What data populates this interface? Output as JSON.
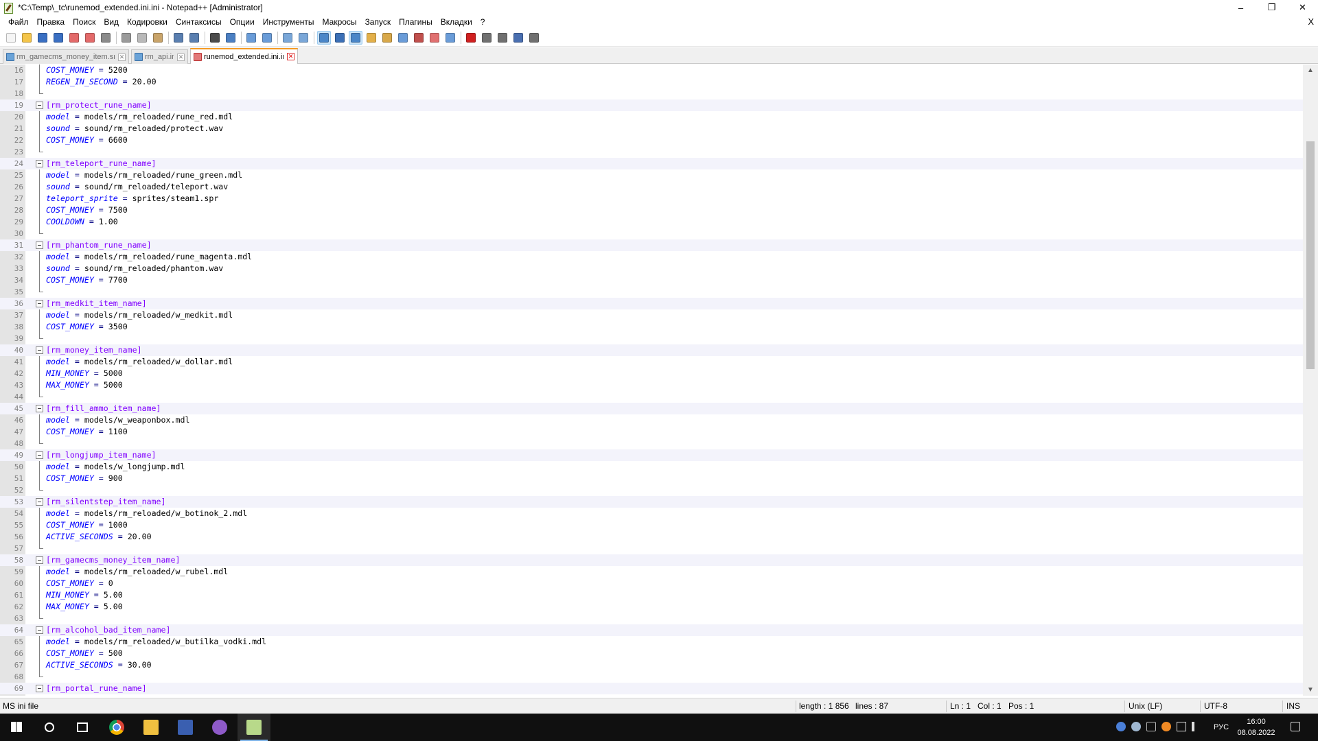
{
  "window": {
    "title": "*C:\\Temp\\_tc\\runemod_extended.ini.ini - Notepad++ [Administrator]",
    "minimize": "–",
    "maximize": "❐",
    "close": "✕"
  },
  "menu": {
    "items": [
      "Файл",
      "Правка",
      "Поиск",
      "Вид",
      "Кодировки",
      "Синтаксисы",
      "Опции",
      "Инструменты",
      "Макросы",
      "Запуск",
      "Плагины",
      "Вкладки",
      "?"
    ],
    "close_doc": "X"
  },
  "toolbar": {
    "buttons": [
      {
        "icon": "new-file-icon",
        "color": "#f5f5f5"
      },
      {
        "icon": "open-file-icon",
        "color": "#f4c54a"
      },
      {
        "icon": "save-icon",
        "color": "#3a6fc2"
      },
      {
        "icon": "save-all-icon",
        "color": "#3a6fc2"
      },
      {
        "icon": "close-icon",
        "color": "#e36a6a"
      },
      {
        "icon": "close-all-icon",
        "color": "#e36a6a"
      },
      {
        "icon": "print-icon",
        "color": "#8a8a8a"
      },
      {
        "sep": true
      },
      {
        "icon": "cut-icon",
        "color": "#9a9a9a"
      },
      {
        "icon": "copy-icon",
        "color": "#b9b9b9"
      },
      {
        "icon": "paste-icon",
        "color": "#c9a46a"
      },
      {
        "sep": true
      },
      {
        "icon": "undo-icon",
        "color": "#5a7fb0"
      },
      {
        "icon": "redo-icon",
        "color": "#5a7fb0"
      },
      {
        "sep": true
      },
      {
        "icon": "find-icon",
        "color": "#4b4b4b"
      },
      {
        "icon": "replace-icon",
        "color": "#4b7fc2"
      },
      {
        "sep": true
      },
      {
        "icon": "zoom-in-icon",
        "color": "#6a9cd8"
      },
      {
        "icon": "zoom-out-icon",
        "color": "#6a9cd8"
      },
      {
        "sep": true
      },
      {
        "icon": "sync-vertical-icon",
        "color": "#7aa7d8"
      },
      {
        "icon": "sync-horizontal-icon",
        "color": "#7aa7d8"
      },
      {
        "sep": true
      },
      {
        "icon": "word-wrap-icon",
        "color": "#4a86c8",
        "active": true
      },
      {
        "icon": "show-all-chars-icon",
        "color": "#3b6fb6"
      },
      {
        "icon": "indent-guide-icon",
        "color": "#4a86c8",
        "active": true
      },
      {
        "icon": "udl-icon",
        "color": "#e3b04a"
      },
      {
        "icon": "doc-map-icon",
        "color": "#d8a84a"
      },
      {
        "icon": "doc-list-icon",
        "color": "#6a9cd8"
      },
      {
        "icon": "function-list-icon",
        "color": "#c0504d"
      },
      {
        "icon": "folder-workspace-icon",
        "color": "#e07070"
      },
      {
        "icon": "monitoring-icon",
        "color": "#6a9cd8"
      },
      {
        "sep": true
      },
      {
        "icon": "record-macro-icon",
        "color": "#d02020"
      },
      {
        "icon": "stop-record-icon",
        "color": "#707070"
      },
      {
        "icon": "play-macro-icon",
        "color": "#707070"
      },
      {
        "icon": "run-macro-multiple-icon",
        "color": "#4a6fb0"
      },
      {
        "icon": "save-macro-icon",
        "color": "#707070"
      }
    ]
  },
  "tabs": [
    {
      "label": "rm_gamecms_money_item.sma",
      "active": false
    },
    {
      "label": "rm_api.inc",
      "active": false
    },
    {
      "label": "runemod_extended.ini.ini",
      "active": true
    }
  ],
  "editor": {
    "lines": [
      {
        "n": "16",
        "type": "kv",
        "key": "COST_MONEY",
        "value": "5200",
        "fold": "line"
      },
      {
        "n": "17",
        "type": "kv",
        "key": "REGEN_IN_SECOND",
        "value": "20.00",
        "fold": "line"
      },
      {
        "n": "18",
        "type": "blank",
        "fold": "end"
      },
      {
        "n": "19",
        "type": "section",
        "text": "[rm_protect_rune_name]",
        "fold": "box"
      },
      {
        "n": "20",
        "type": "kv",
        "key": "model",
        "value": "models/rm_reloaded/rune_red.mdl",
        "fold": "line"
      },
      {
        "n": "21",
        "type": "kv",
        "key": "sound",
        "value": "sound/rm_reloaded/protect.wav",
        "fold": "line"
      },
      {
        "n": "22",
        "type": "kv",
        "key": "COST_MONEY",
        "value": "6600",
        "fold": "line"
      },
      {
        "n": "23",
        "type": "blank",
        "fold": "end"
      },
      {
        "n": "24",
        "type": "section",
        "text": "[rm_teleport_rune_name]",
        "fold": "box"
      },
      {
        "n": "25",
        "type": "kv",
        "key": "model",
        "value": "models/rm_reloaded/rune_green.mdl",
        "fold": "line"
      },
      {
        "n": "26",
        "type": "kv",
        "key": "sound",
        "value": "sound/rm_reloaded/teleport.wav",
        "fold": "line"
      },
      {
        "n": "27",
        "type": "kv",
        "key": "teleport_sprite",
        "value": "sprites/steam1.spr",
        "fold": "line"
      },
      {
        "n": "28",
        "type": "kv",
        "key": "COST_MONEY",
        "value": "7500",
        "fold": "line"
      },
      {
        "n": "29",
        "type": "kv",
        "key": "COOLDOWN",
        "value": "1.00",
        "fold": "line"
      },
      {
        "n": "30",
        "type": "blank",
        "fold": "end"
      },
      {
        "n": "31",
        "type": "section",
        "text": "[rm_phantom_rune_name]",
        "fold": "box"
      },
      {
        "n": "32",
        "type": "kv",
        "key": "model",
        "value": "models/rm_reloaded/rune_magenta.mdl",
        "fold": "line"
      },
      {
        "n": "33",
        "type": "kv",
        "key": "sound",
        "value": "sound/rm_reloaded/phantom.wav",
        "fold": "line"
      },
      {
        "n": "34",
        "type": "kv",
        "key": "COST_MONEY",
        "value": "7700",
        "fold": "line"
      },
      {
        "n": "35",
        "type": "blank",
        "fold": "end"
      },
      {
        "n": "36",
        "type": "section",
        "text": "[rm_medkit_item_name]",
        "fold": "box"
      },
      {
        "n": "37",
        "type": "kv",
        "key": "model",
        "value": "models/rm_reloaded/w_medkit.mdl",
        "fold": "line"
      },
      {
        "n": "38",
        "type": "kv",
        "key": "COST_MONEY",
        "value": "3500",
        "fold": "line"
      },
      {
        "n": "39",
        "type": "blank",
        "fold": "end"
      },
      {
        "n": "40",
        "type": "section",
        "text": "[rm_money_item_name]",
        "fold": "box"
      },
      {
        "n": "41",
        "type": "kv",
        "key": "model",
        "value": "models/rm_reloaded/w_dollar.mdl",
        "fold": "line"
      },
      {
        "n": "42",
        "type": "kv",
        "key": "MIN_MONEY",
        "value": "5000",
        "fold": "line"
      },
      {
        "n": "43",
        "type": "kv",
        "key": "MAX_MONEY",
        "value": "5000",
        "fold": "line"
      },
      {
        "n": "44",
        "type": "blank",
        "fold": "end"
      },
      {
        "n": "45",
        "type": "section",
        "text": "[rm_fill_ammo_item_name]",
        "fold": "box"
      },
      {
        "n": "46",
        "type": "kv",
        "key": "model",
        "value": "models/w_weaponbox.mdl",
        "fold": "line"
      },
      {
        "n": "47",
        "type": "kv",
        "key": "COST_MONEY",
        "value": "1100",
        "fold": "line"
      },
      {
        "n": "48",
        "type": "blank",
        "fold": "end"
      },
      {
        "n": "49",
        "type": "section",
        "text": "[rm_longjump_item_name]",
        "fold": "box"
      },
      {
        "n": "50",
        "type": "kv",
        "key": "model",
        "value": "models/w_longjump.mdl",
        "fold": "line"
      },
      {
        "n": "51",
        "type": "kv",
        "key": "COST_MONEY",
        "value": "900",
        "fold": "line"
      },
      {
        "n": "52",
        "type": "blank",
        "fold": "end"
      },
      {
        "n": "53",
        "type": "section",
        "text": "[rm_silentstep_item_name]",
        "fold": "box"
      },
      {
        "n": "54",
        "type": "kv",
        "key": "model",
        "value": "models/rm_reloaded/w_botinok_2.mdl",
        "fold": "line"
      },
      {
        "n": "55",
        "type": "kv",
        "key": "COST_MONEY",
        "value": "1000",
        "fold": "line"
      },
      {
        "n": "56",
        "type": "kv",
        "key": "ACTIVE_SECONDS",
        "value": "20.00",
        "fold": "line"
      },
      {
        "n": "57",
        "type": "blank",
        "fold": "end"
      },
      {
        "n": "58",
        "type": "section",
        "text": "[rm_gamecms_money_item_name]",
        "fold": "box"
      },
      {
        "n": "59",
        "type": "kv",
        "key": "model",
        "value": "models/rm_reloaded/w_rubel.mdl",
        "fold": "line"
      },
      {
        "n": "60",
        "type": "kv",
        "key": "COST_MONEY",
        "value": "0",
        "fold": "line"
      },
      {
        "n": "61",
        "type": "kv",
        "key": "MIN_MONEY",
        "value": "5.00",
        "fold": "line"
      },
      {
        "n": "62",
        "type": "kv",
        "key": "MAX_MONEY",
        "value": "5.00",
        "fold": "line"
      },
      {
        "n": "63",
        "type": "blank",
        "fold": "end"
      },
      {
        "n": "64",
        "type": "section",
        "text": "[rm_alcohol_bad_item_name]",
        "fold": "box"
      },
      {
        "n": "65",
        "type": "kv",
        "key": "model",
        "value": "models/rm_reloaded/w_butilka_vodki.mdl",
        "fold": "line"
      },
      {
        "n": "66",
        "type": "kv",
        "key": "COST_MONEY",
        "value": "500",
        "fold": "line"
      },
      {
        "n": "67",
        "type": "kv",
        "key": "ACTIVE_SECONDS",
        "value": "30.00",
        "fold": "line"
      },
      {
        "n": "68",
        "type": "blank",
        "fold": "end"
      },
      {
        "n": "69",
        "type": "section",
        "text": "[rm_portal_rune_name]",
        "fold": "box"
      }
    ]
  },
  "scrollbar": {
    "up": "▲",
    "down": "▼"
  },
  "status": {
    "file_type": "MS ini file",
    "length": "length : 1 856",
    "lines": "lines : 87",
    "ln": "Ln : 1",
    "col": "Col : 1",
    "pos": "Pos : 1",
    "eol": "Unix (LF)",
    "encoding": "UTF-8",
    "mode": "INS"
  },
  "taskbar": {
    "apps": [
      {
        "name": "start-button",
        "icon": "windows-icon",
        "active": false
      },
      {
        "name": "search-button",
        "icon": "search-icon",
        "active": false
      },
      {
        "name": "task-view-button",
        "icon": "task-view-icon",
        "active": false
      },
      {
        "name": "chrome-app",
        "icon": "chrome-icon",
        "active": false
      },
      {
        "name": "explorer-app",
        "icon": "folder-icon",
        "active": false
      },
      {
        "name": "save-app",
        "icon": "floppy-icon",
        "active": false
      },
      {
        "name": "github-app",
        "icon": "github-icon",
        "active": false
      },
      {
        "name": "notepadpp-app",
        "icon": "notepadpp-icon",
        "active": true
      }
    ],
    "language": "РУС",
    "time": "16:00",
    "date": "08.08.2022"
  }
}
